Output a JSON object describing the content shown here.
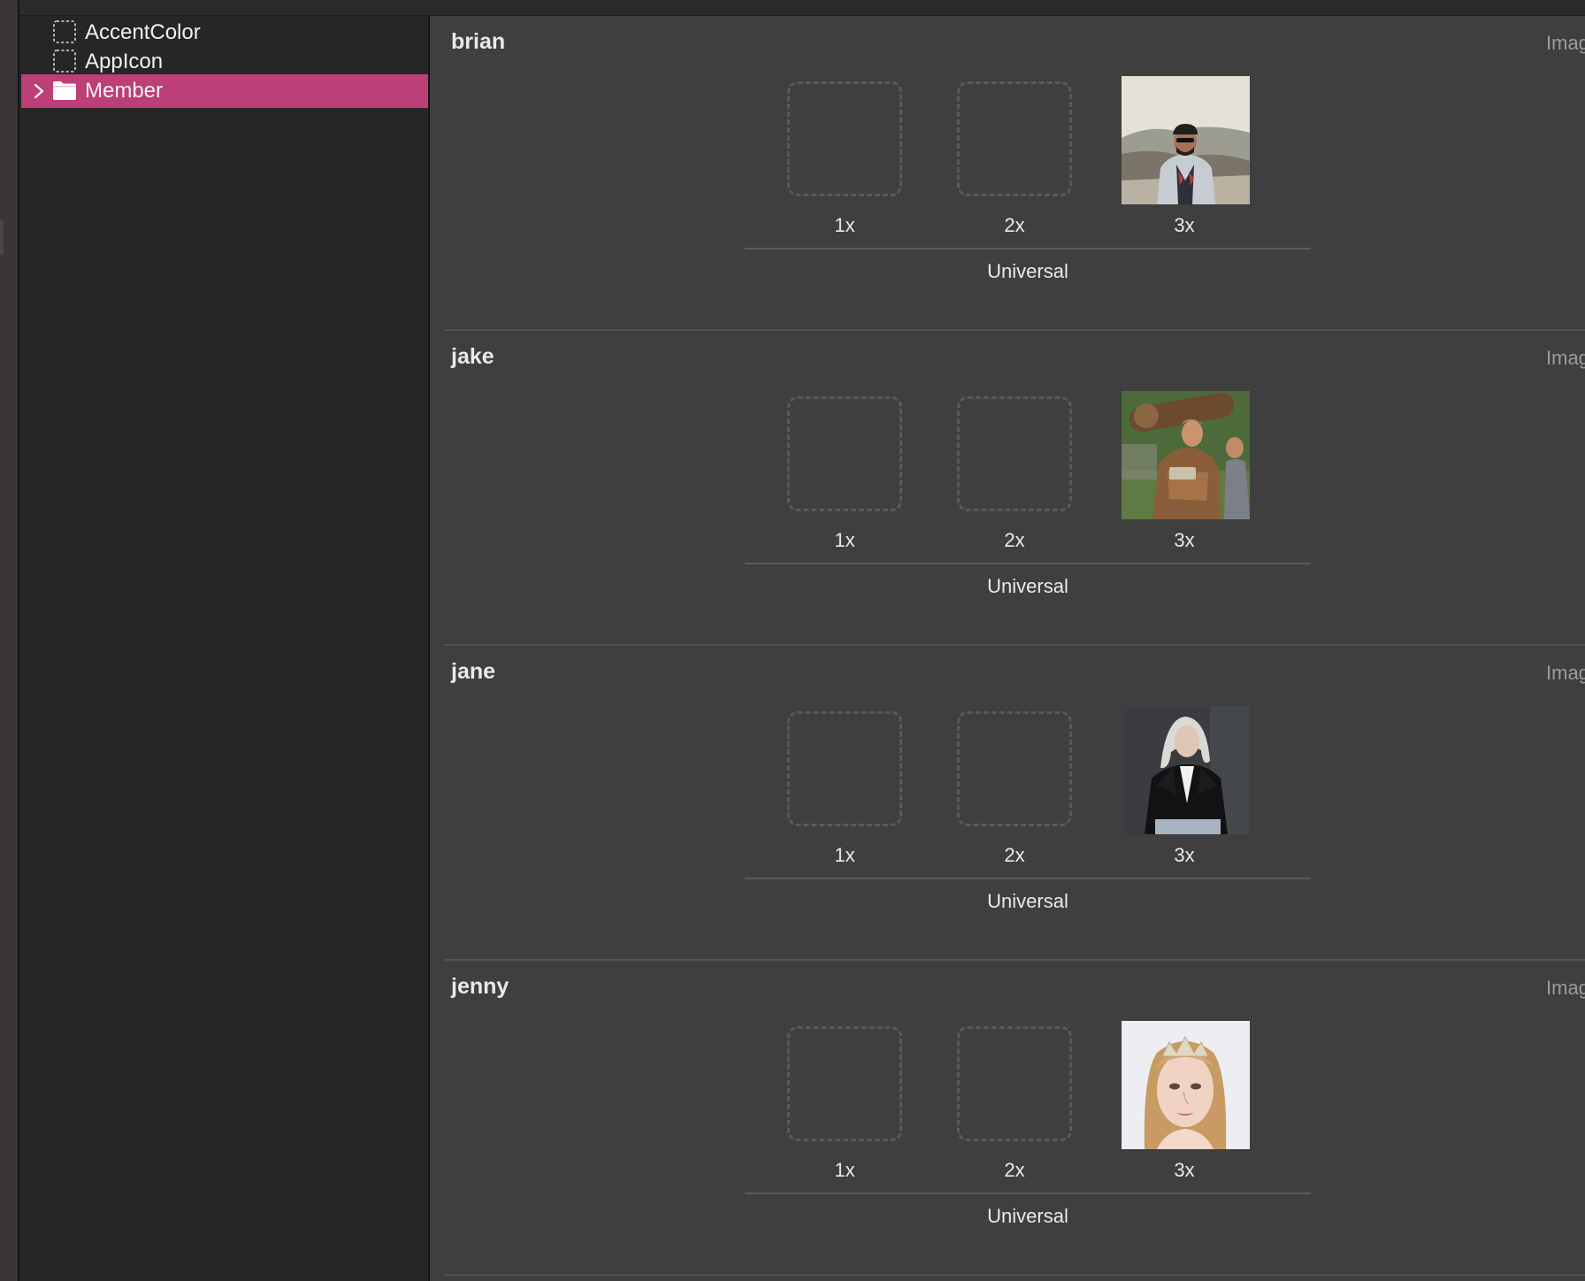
{
  "sidebar": {
    "items": [
      {
        "label": "AccentColor",
        "icon": "dashed-square-icon",
        "selected": false
      },
      {
        "label": "AppIcon",
        "icon": "dashed-square-icon",
        "selected": false
      },
      {
        "label": "Member",
        "icon": "folder-icon",
        "selected": true,
        "expandable": true
      }
    ],
    "selected_color": "#bc3f77"
  },
  "asset_sets": [
    {
      "name": "brian",
      "type_label": "Imag",
      "slots": [
        "1x",
        "2x",
        "3x"
      ],
      "filled_slot": "3x",
      "idiom": "Universal"
    },
    {
      "name": "jake",
      "type_label": "Imag",
      "slots": [
        "1x",
        "2x",
        "3x"
      ],
      "filled_slot": "3x",
      "idiom": "Universal"
    },
    {
      "name": "jane",
      "type_label": "Imag",
      "slots": [
        "1x",
        "2x",
        "3x"
      ],
      "filled_slot": "3x",
      "idiom": "Universal"
    },
    {
      "name": "jenny",
      "type_label": "Imag",
      "slots": [
        "1x",
        "2x",
        "3x"
      ],
      "filled_slot": "3x",
      "idiom": "Universal"
    }
  ]
}
